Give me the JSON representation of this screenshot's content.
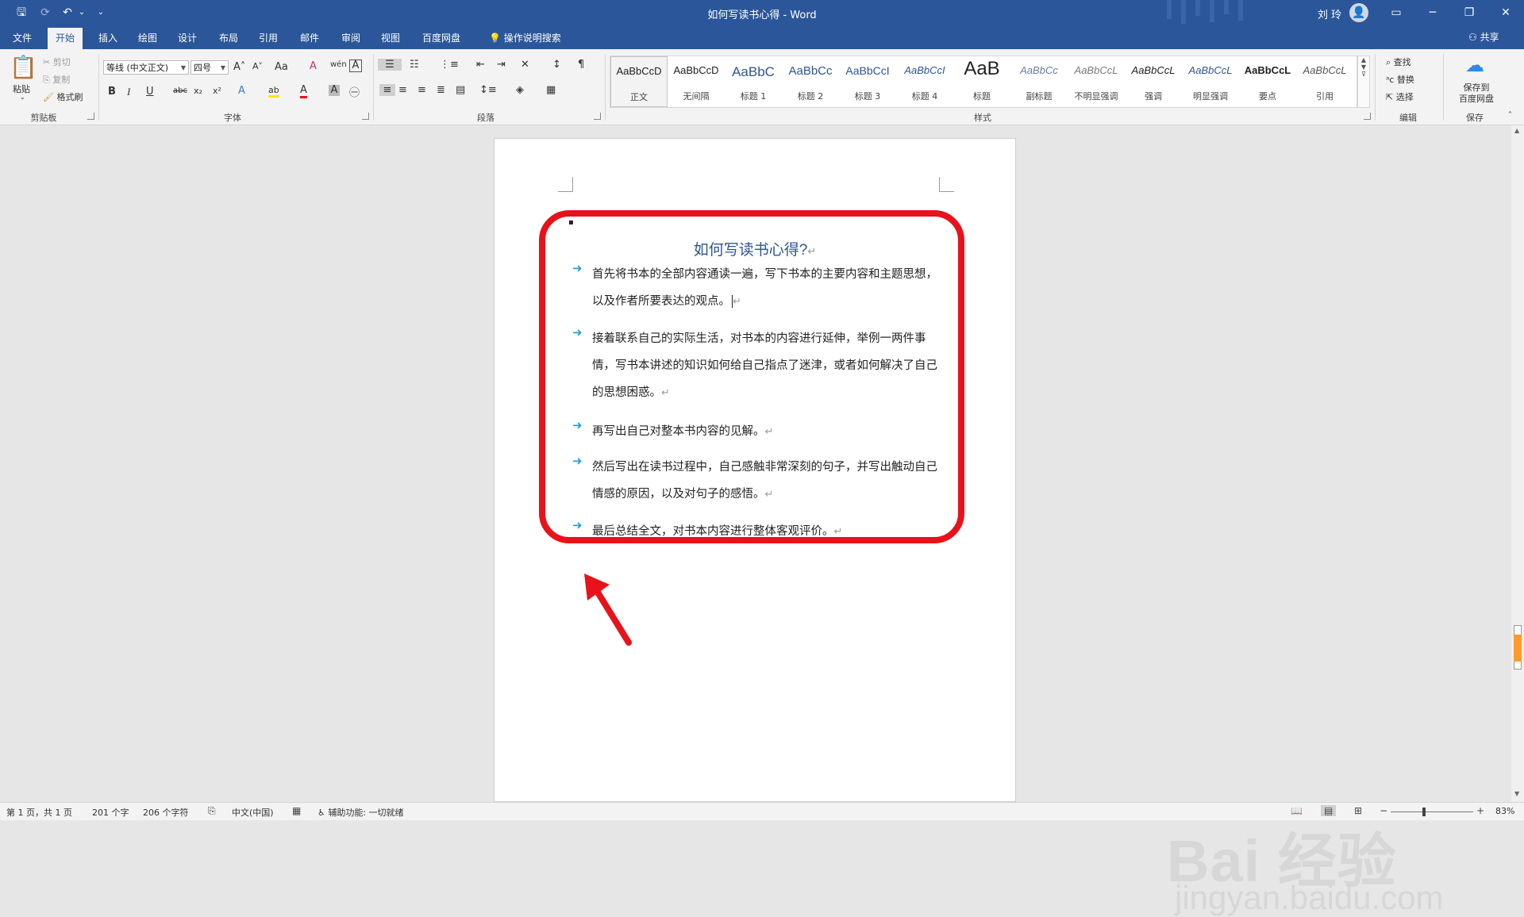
{
  "window": {
    "title": "如何写读书心得 - Word",
    "user_name": "刘 玲",
    "avatar_glyph": "👤",
    "controls": {
      "ribbon_options": "▭",
      "minimize": "─",
      "restore": "❐",
      "close": "✕"
    },
    "quick_access": {
      "save": "🖫",
      "redo": "⟳",
      "undo": "↶",
      "undo_more": "⌄",
      "customize": "⌄"
    }
  },
  "tabs": [
    {
      "label": "文件",
      "active": false
    },
    {
      "label": "开始",
      "active": true
    },
    {
      "label": "插入",
      "active": false
    },
    {
      "label": "绘图",
      "active": false
    },
    {
      "label": "设计",
      "active": false
    },
    {
      "label": "布局",
      "active": false
    },
    {
      "label": "引用",
      "active": false
    },
    {
      "label": "邮件",
      "active": false
    },
    {
      "label": "审阅",
      "active": false
    },
    {
      "label": "视图",
      "active": false
    },
    {
      "label": "百度网盘",
      "active": false
    }
  ],
  "tell_me": {
    "icon": "lightbulb-icon",
    "label": "操作说明搜索"
  },
  "share_label": "共享",
  "ribbon": {
    "clipboard": {
      "group_label": "剪贴板",
      "paste": "粘贴",
      "cut": "剪切",
      "copy": "复制",
      "format_painter": "格式刷"
    },
    "font": {
      "group_label": "字体",
      "font_name": "等线 (中文正文)",
      "font_size": "四号",
      "grow": "A˄",
      "shrink": "A˅",
      "change_case": "Aa",
      "clear_format": "A",
      "phonetic": "wén",
      "char_border": "A",
      "bold": "B",
      "italic": "I",
      "underline": "U",
      "strikethrough": "abc",
      "subscript": "x₂",
      "superscript": "x²",
      "text_effects": "A",
      "highlight": "ab",
      "font_color": "A",
      "char_shading": "A",
      "enclose": "㊀"
    },
    "paragraph": {
      "group_label": "段落"
    },
    "styles": {
      "group_label": "样式",
      "items": [
        {
          "sample": "AaBbCcD",
          "name": "正文",
          "selected": true,
          "size": 13,
          "color": "#222222",
          "italic": false,
          "bold": false
        },
        {
          "sample": "AaBbCcD",
          "name": "无间隔",
          "selected": false,
          "size": 13,
          "color": "#222222",
          "italic": false,
          "bold": false
        },
        {
          "sample": "AaBbC",
          "name": "标题 1",
          "selected": false,
          "size": 17,
          "color": "#2f5496",
          "italic": false,
          "bold": false
        },
        {
          "sample": "AaBbCc",
          "name": "标题 2",
          "selected": false,
          "size": 15,
          "color": "#2f5496",
          "italic": false,
          "bold": false
        },
        {
          "sample": "AaBbCcI",
          "name": "标题 3",
          "selected": false,
          "size": 14,
          "color": "#2f5496",
          "italic": false,
          "bold": false
        },
        {
          "sample": "AaBbCcI",
          "name": "标题 4",
          "selected": false,
          "size": 13,
          "color": "#2f5496",
          "italic": true,
          "bold": false
        },
        {
          "sample": "AaB",
          "name": "标题",
          "selected": false,
          "size": 24,
          "color": "#222222",
          "italic": false,
          "bold": false
        },
        {
          "sample": "AaBbCc",
          "name": "副标题",
          "selected": false,
          "size": 13,
          "color": "#6b7fa6",
          "italic": true,
          "bold": false
        },
        {
          "sample": "AaBbCcL",
          "name": "不明显强调",
          "selected": false,
          "size": 13,
          "color": "#7a7a7a",
          "italic": true,
          "bold": false
        },
        {
          "sample": "AaBbCcL",
          "name": "强调",
          "selected": false,
          "size": 13,
          "color": "#222222",
          "italic": true,
          "bold": false
        },
        {
          "sample": "AaBbCcL",
          "name": "明显强调",
          "selected": false,
          "size": 13,
          "color": "#2f5496",
          "italic": true,
          "bold": false
        },
        {
          "sample": "AaBbCcL",
          "name": "要点",
          "selected": false,
          "size": 13,
          "color": "#222222",
          "italic": false,
          "bold": true
        },
        {
          "sample": "AaBbCcL",
          "name": "引用",
          "selected": false,
          "size": 13,
          "color": "#555555",
          "italic": true,
          "bold": false
        }
      ]
    },
    "editing": {
      "group_label": "编辑",
      "find": "查找",
      "replace": "替换",
      "select": "选择"
    },
    "save": {
      "group_label": "保存",
      "label": "保存到\n百度网盘"
    }
  },
  "document": {
    "heading": "如何写读书心得?",
    "para_mark": "↵",
    "paragraphs": [
      "首先将书本的全部内容通读一遍，写下书本的主要内容和主题思想，以及作者所要表达的观点。",
      "接着联系自己的实际生活，对书本的内容进行延伸，举例一两件事情，写书本讲述的知识如何给自己指点了迷津，或者如何解决了自己的思想困惑。",
      "再写出自己对整本书内容的见解。",
      "然后写出在读书过程中，自己感触非常深刻的句子，并写出触动自己情感的原因，以及对句子的感悟。",
      "最后总结全文，对书本内容进行整体客观评价。"
    ],
    "highlight_color": "#e8121b"
  },
  "watermark": {
    "main": "Bai 经验",
    "sub": "jingyan.baidu.com"
  },
  "statusbar": {
    "page": "第 1 页，共 1 页",
    "words": "201 个字",
    "chars": "206 个字符",
    "language": "中文(中国)",
    "accessibility": "辅助功能: 一切就绪",
    "zoom": "83%",
    "zoom_level": 0.83
  },
  "colors": {
    "brand": "#2b579a",
    "accent_blue": "#2f5496",
    "bullet": "#2c9fd6",
    "scroll_orange": "#ff9b2b"
  }
}
